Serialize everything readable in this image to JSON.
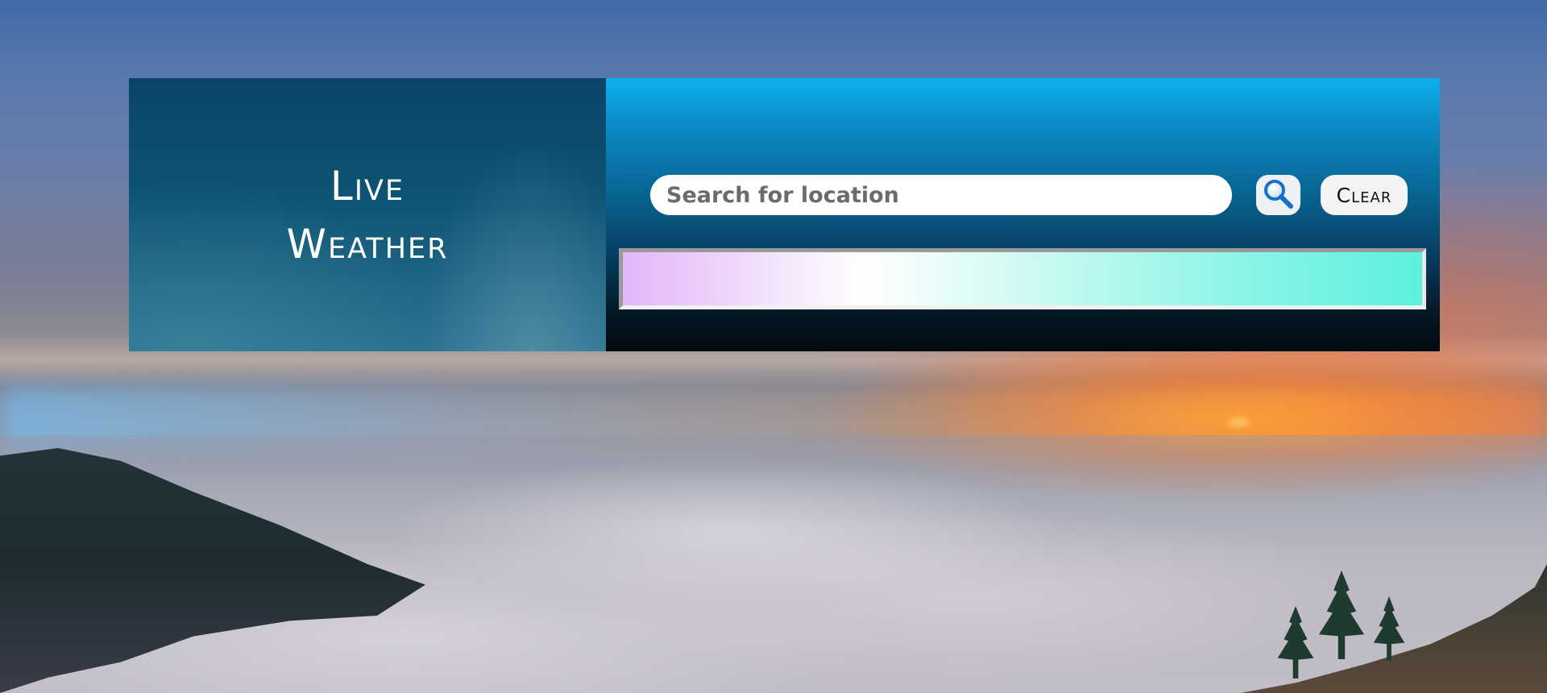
{
  "brand": {
    "title_line1": "Live",
    "title_line2": "Weather"
  },
  "search": {
    "placeholder": "Search for location",
    "value": "",
    "search_icon": "magnifier-icon",
    "clear_label": "Clear"
  },
  "result": {
    "text": ""
  },
  "colors": {
    "accent": "#0eaff0",
    "brand_panel": "#0e5474",
    "result_start": "#e3b6fb",
    "result_end": "#5cf0de"
  }
}
